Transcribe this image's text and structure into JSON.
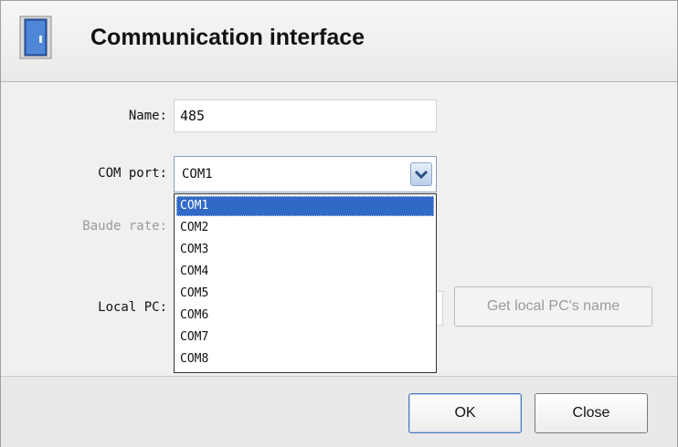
{
  "dialog": {
    "title": "Communication interface",
    "icon": "door-icon"
  },
  "form": {
    "name_label": "Name:",
    "name_value": "485",
    "com_port_label": "COM port:",
    "com_port_value": "COM1",
    "baud_rate_label": "Baude rate:",
    "local_pc_label": "Local PC:",
    "get_local_pc_button": "Get local PC's name"
  },
  "dropdown": {
    "options": [
      "COM1",
      "COM2",
      "COM3",
      "COM4",
      "COM5",
      "COM6",
      "COM7",
      "COM8"
    ],
    "selected": "COM1"
  },
  "footer": {
    "ok_label": "OK",
    "close_label": "Close"
  },
  "colors": {
    "selection": "#3169c6",
    "dialog_bg": "#f0f0f0"
  }
}
